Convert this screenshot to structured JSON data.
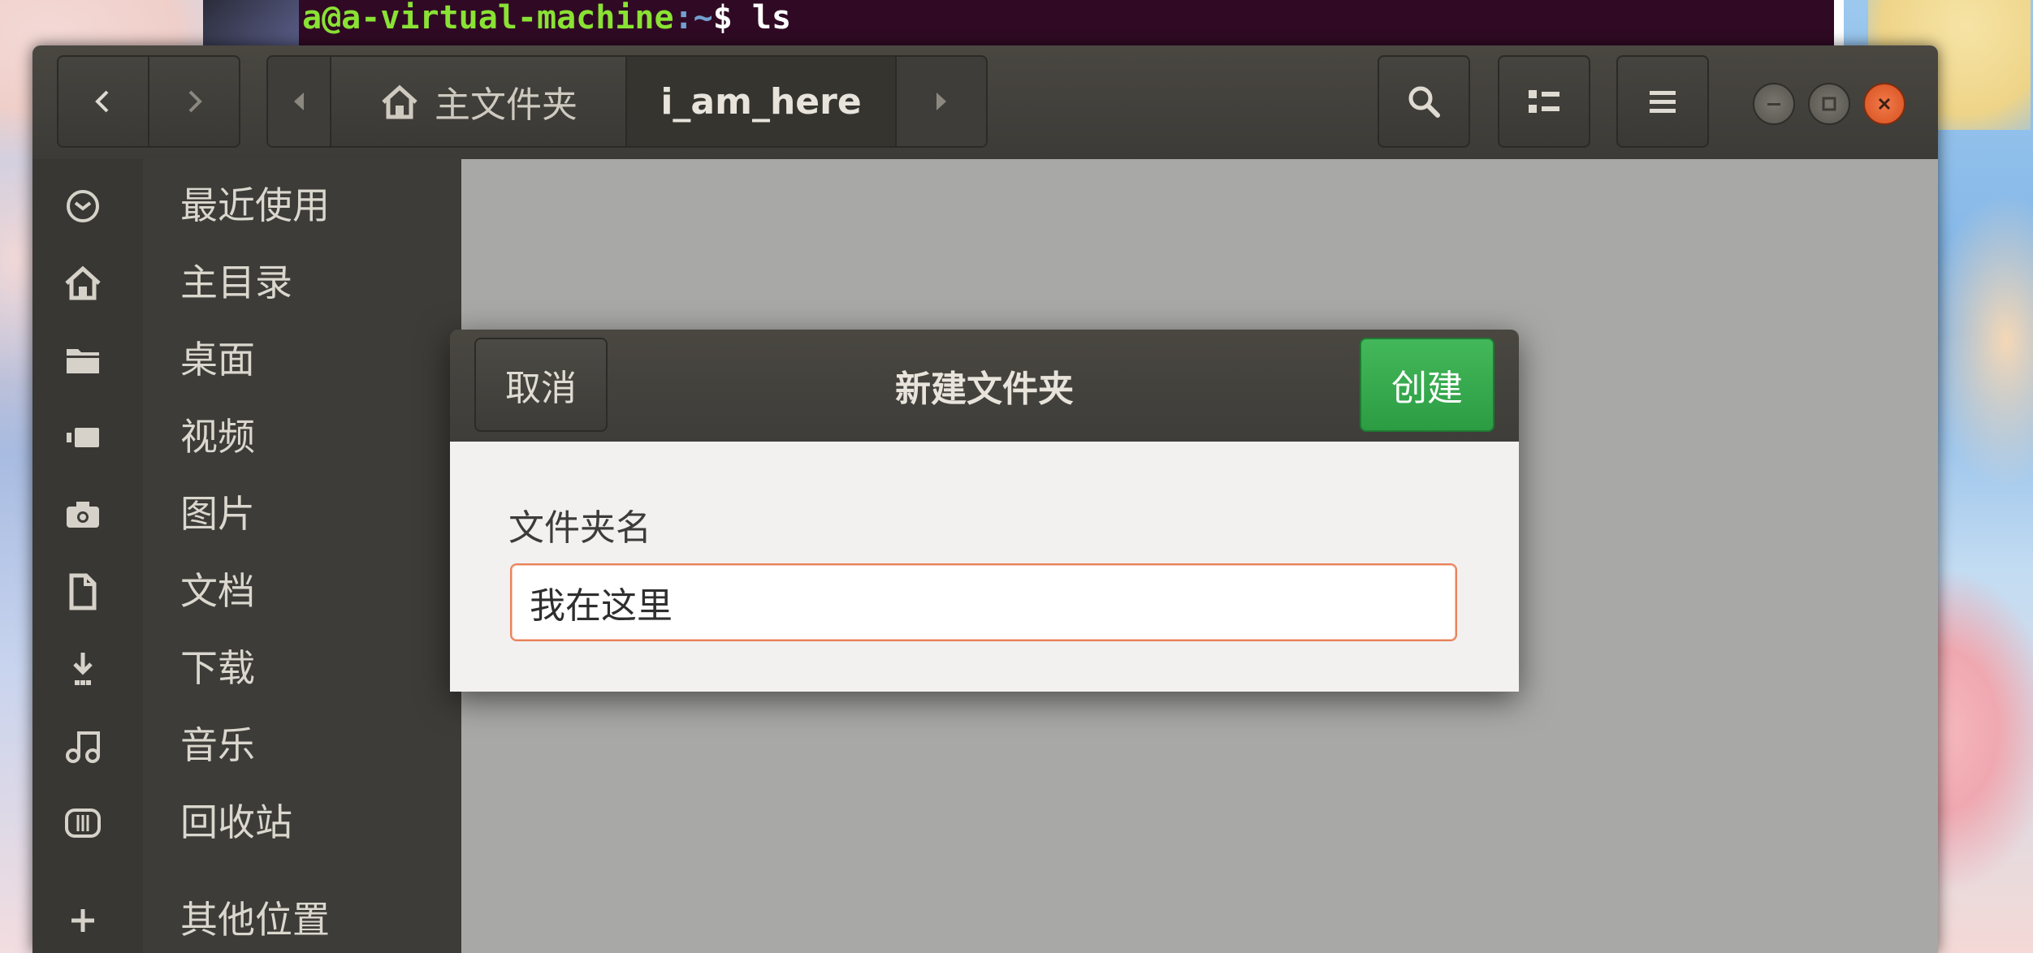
{
  "terminal": {
    "user_host": "a@a-virtual-machine",
    "path": ":~",
    "prompt_cmd": "$ ls"
  },
  "file_manager": {
    "pathbar": {
      "home_label": "主文件夹",
      "current_label": "i_am_here"
    },
    "sidebar": {
      "items": [
        {
          "label": "最近使用",
          "icon": "clock-icon"
        },
        {
          "label": "主目录",
          "icon": "home-icon"
        },
        {
          "label": "桌面",
          "icon": "folder-icon"
        },
        {
          "label": "视频",
          "icon": "video-icon"
        },
        {
          "label": "图片",
          "icon": "camera-icon"
        },
        {
          "label": "文档",
          "icon": "document-icon"
        },
        {
          "label": "下载",
          "icon": "download-icon"
        },
        {
          "label": "音乐",
          "icon": "music-icon"
        },
        {
          "label": "回收站",
          "icon": "trash-icon"
        },
        {
          "label": "其他位置",
          "icon": "plus-icon"
        }
      ]
    }
  },
  "dialog": {
    "title": "新建文件夹",
    "cancel_label": "取消",
    "create_label": "创建",
    "field_label": "文件夹名",
    "field_value": "我在这里"
  },
  "colors": {
    "accent_create": "#2c9c43",
    "input_focus": "#e9825b",
    "close_button": "#e05a2a"
  }
}
